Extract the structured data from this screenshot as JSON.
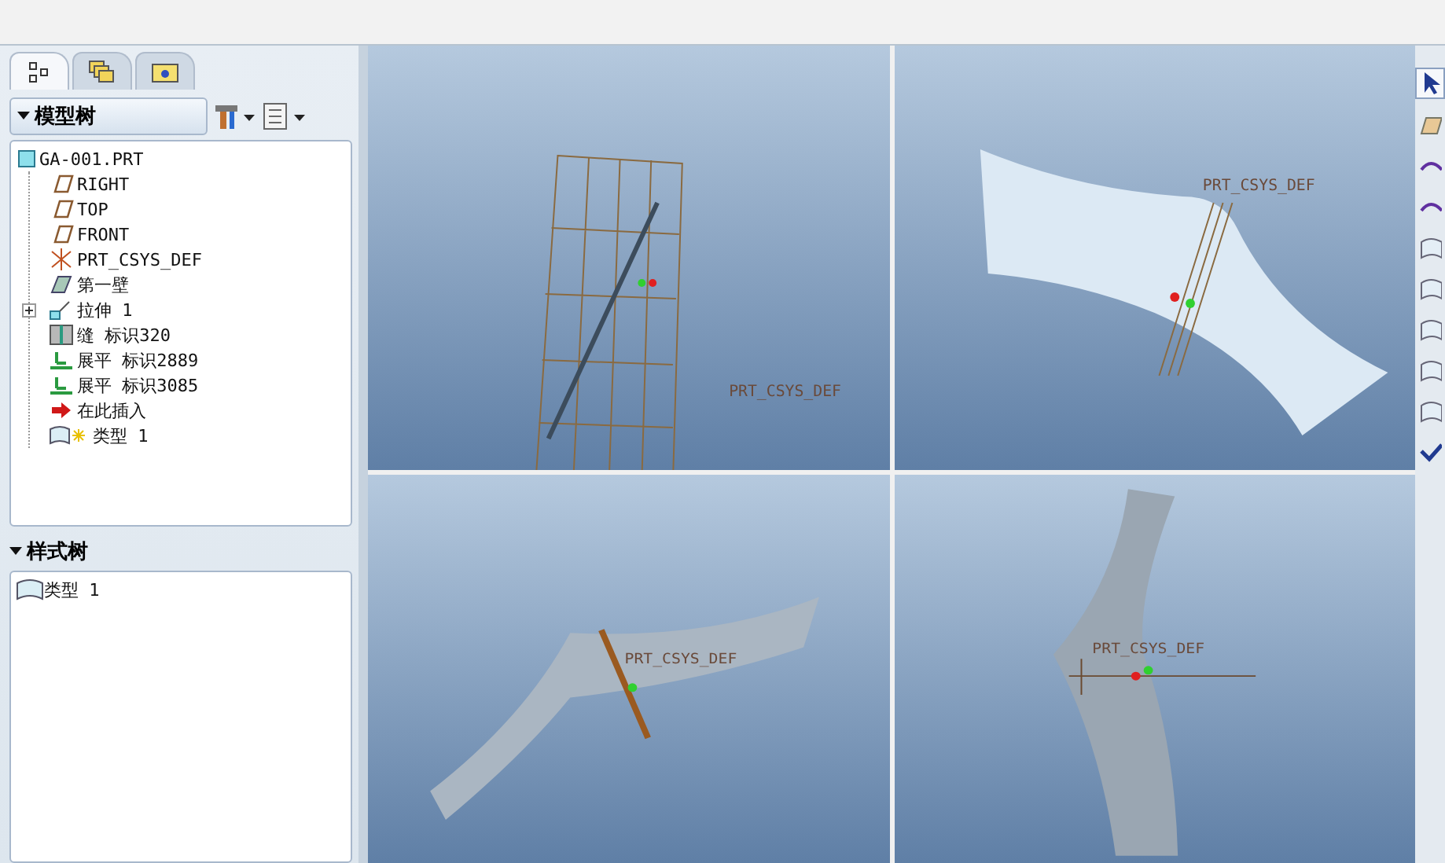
{
  "tabs": [
    {
      "kind": "tree",
      "selected": true
    },
    {
      "kind": "layers",
      "selected": false
    },
    {
      "kind": "folder",
      "selected": false
    }
  ],
  "model_tree": {
    "title": "模型树",
    "items": [
      {
        "label": "GA-001.PRT",
        "kind": "part",
        "children": [
          {
            "label": "RIGHT",
            "kind": "plane"
          },
          {
            "label": "TOP",
            "kind": "plane"
          },
          {
            "label": "FRONT",
            "kind": "plane"
          },
          {
            "label": "PRT_CSYS_DEF",
            "kind": "csys"
          },
          {
            "label": "第一壁",
            "kind": "wall"
          },
          {
            "label": "拉伸 1",
            "kind": "extrude",
            "expanded": false
          },
          {
            "label": "缝 标识320",
            "kind": "seam"
          },
          {
            "label": "展平 标识2889",
            "kind": "flatten"
          },
          {
            "label": "展平 标识3085",
            "kind": "flatten"
          },
          {
            "label": "在此插入",
            "kind": "insert"
          },
          {
            "label": "类型 1",
            "kind": "style"
          }
        ]
      }
    ]
  },
  "style_tree": {
    "title": "样式树",
    "items": [
      {
        "label": "类型 1",
        "kind": "surface"
      }
    ]
  },
  "viewports": [
    {
      "kind": "front",
      "csys_label": "PRT_CSYS_DEF"
    },
    {
      "kind": "iso",
      "csys_label": "PRT_CSYS_DEF"
    },
    {
      "kind": "oblique",
      "csys_label": "PRT_CSYS_DEF"
    },
    {
      "kind": "side",
      "csys_label": "PRT_CSYS_DEF"
    }
  ],
  "toolbar": [
    {
      "kind": "select",
      "selected": true
    },
    {
      "kind": "plane",
      "selected": false
    },
    {
      "kind": "curve",
      "selected": false
    },
    {
      "kind": "curve",
      "selected": false
    },
    {
      "kind": "surface",
      "selected": false
    },
    {
      "kind": "surface",
      "selected": false
    },
    {
      "kind": "surface",
      "selected": false
    },
    {
      "kind": "surface",
      "selected": false
    },
    {
      "kind": "surface",
      "selected": false
    },
    {
      "kind": "done",
      "selected": false
    }
  ]
}
